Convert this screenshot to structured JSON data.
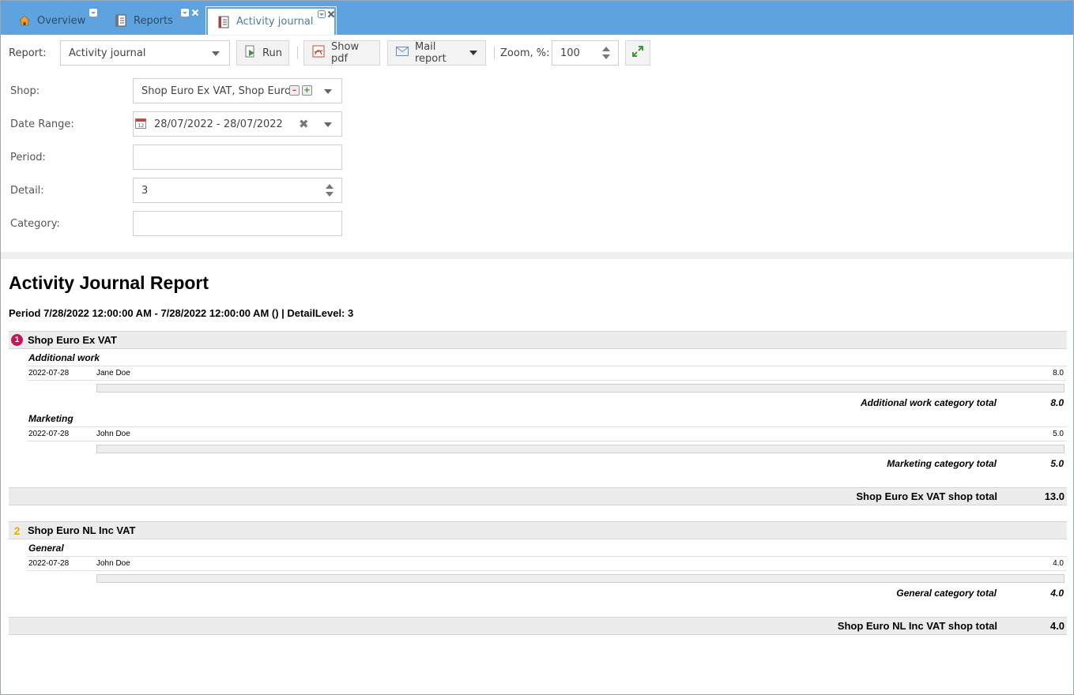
{
  "tabs": [
    {
      "label": "Overview",
      "icon": "home-icon"
    },
    {
      "label": "Reports",
      "icon": "report-book-icon"
    },
    {
      "label": "Activity journal",
      "icon": "report-book-icon",
      "active": true
    }
  ],
  "toolbar": {
    "report_label": "Report:",
    "report_value": "Activity journal",
    "run_label": "Run",
    "pdf_label": "Show pdf",
    "mail_label": "Mail report",
    "zoom_label": "Zoom, %:",
    "zoom_value": "100"
  },
  "params": {
    "shop_label": "Shop:",
    "shop_value": "Shop Euro Ex VAT, Shop Euro",
    "date_label": "Date Range:",
    "date_value": "28/07/2022 - 28/07/2022",
    "period_label": "Period:",
    "period_value": "",
    "detail_label": "Detail:",
    "detail_value": "3",
    "category_label": "Category:",
    "category_value": ""
  },
  "report": {
    "title": "Activity Journal Report",
    "subtitle": "Period 7/28/2022 12:00:00 AM - 7/28/2022 12:00:00 AM () | DetailLevel: 3",
    "shops": [
      {
        "badge": "1",
        "name": "Shop Euro Ex VAT",
        "categories": [
          {
            "name": "Additional work",
            "rows": [
              {
                "date": "2022-07-28",
                "person": "Jane Doe",
                "value": "8.0"
              }
            ],
            "total_label": "Additional work category total",
            "total": "8.0"
          },
          {
            "name": "Marketing",
            "rows": [
              {
                "date": "2022-07-28",
                "person": "John Doe",
                "value": "5.0"
              }
            ],
            "total_label": "Marketing category total",
            "total": "5.0"
          }
        ],
        "total_label": "Shop Euro Ex VAT shop total",
        "total": "13.0"
      },
      {
        "badge": "2",
        "name": "Shop Euro NL Inc VAT",
        "categories": [
          {
            "name": "General",
            "rows": [
              {
                "date": "2022-07-28",
                "person": "John Doe",
                "value": "4.0"
              }
            ],
            "total_label": "General category total",
            "total": "4.0"
          }
        ],
        "total_label": "Shop Euro NL Inc VAT shop total",
        "total": "4.0"
      }
    ]
  },
  "colors": {
    "tabbar": "#5ea2df",
    "badge1": "#c2185b",
    "badge2": "#e0b000",
    "section_bg": "#ececec"
  }
}
